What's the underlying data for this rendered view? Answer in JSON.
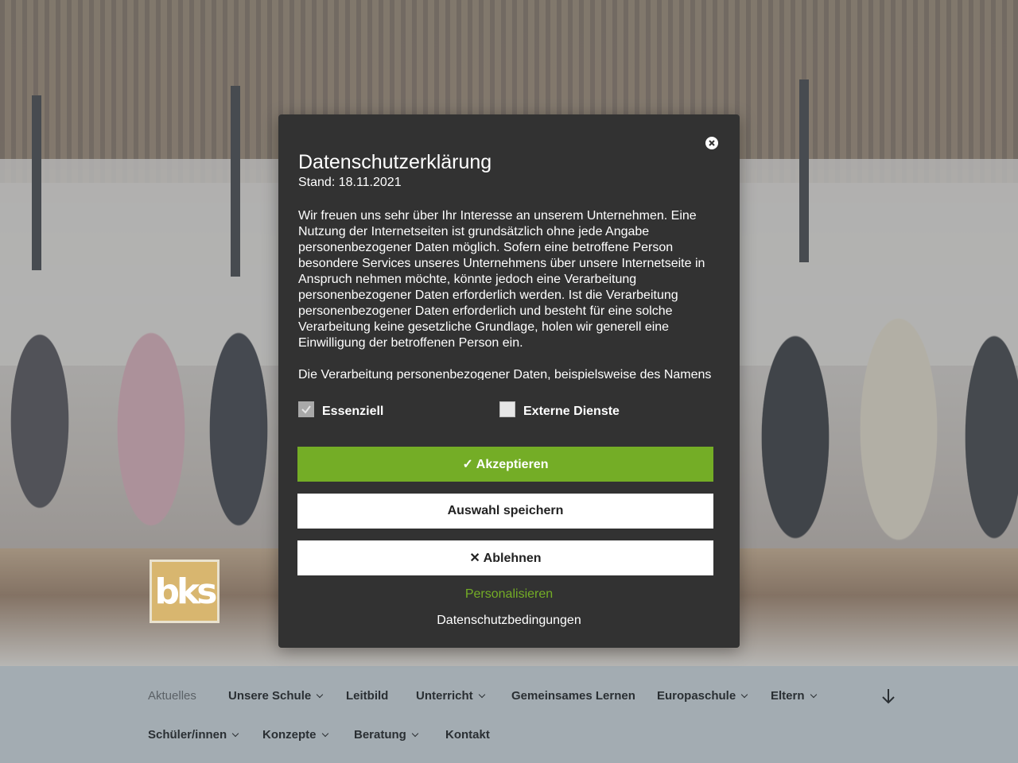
{
  "modal": {
    "title": "Datenschutzerklärung",
    "stand": "Stand: 18.11.2021",
    "paragraphs": [
      "Wir freuen uns sehr über Ihr Interesse an unserem Unternehmen. Eine Nutzung der Internetseiten ist grundsätzlich ohne jede Angabe personenbezogener Daten möglich. Sofern eine betroffene Person besondere Services unseres Unternehmens über unsere Internetseite in Anspruch nehmen möchte, könnte jedoch eine Verarbeitung personenbezogener Daten erforderlich werden. Ist die Verarbeitung personenbezogener Daten erforderlich und besteht für eine solche Verarbeitung keine gesetzliche Grundlage, holen wir generell eine Einwilligung der betroffenen Person ein.",
      "Die Verarbeitung personenbezogener Daten, beispielsweise des Namens"
    ],
    "checkboxes": [
      {
        "label": "Essenziell",
        "checked": true
      },
      {
        "label": "Externe Dienste",
        "checked": false
      }
    ],
    "accept_label": "✓ Akzeptieren",
    "save_label": "Auswahl speichern",
    "decline_label": "✕ Ablehnen",
    "personalize_label": "Personalisieren",
    "privacy_link": "Datenschutzbedingungen",
    "accent_color": "#74ad26"
  },
  "logo": {
    "text": "bks"
  },
  "nav": {
    "items": [
      {
        "label": "Aktuelles",
        "dropdown": false,
        "active": true
      },
      {
        "label": "Unsere Schule",
        "dropdown": true
      },
      {
        "label": "Leitbild",
        "dropdown": false
      },
      {
        "label": "Unterricht",
        "dropdown": true
      },
      {
        "label": "Gemeinsames Lernen",
        "dropdown": false
      },
      {
        "label": "Europaschule",
        "dropdown": true
      },
      {
        "label": "Eltern",
        "dropdown": true
      },
      {
        "label": "Schüler/innen",
        "dropdown": true
      },
      {
        "label": "Konzepte",
        "dropdown": true
      },
      {
        "label": "Beratung",
        "dropdown": true
      },
      {
        "label": "Kontakt",
        "dropdown": false
      }
    ]
  }
}
